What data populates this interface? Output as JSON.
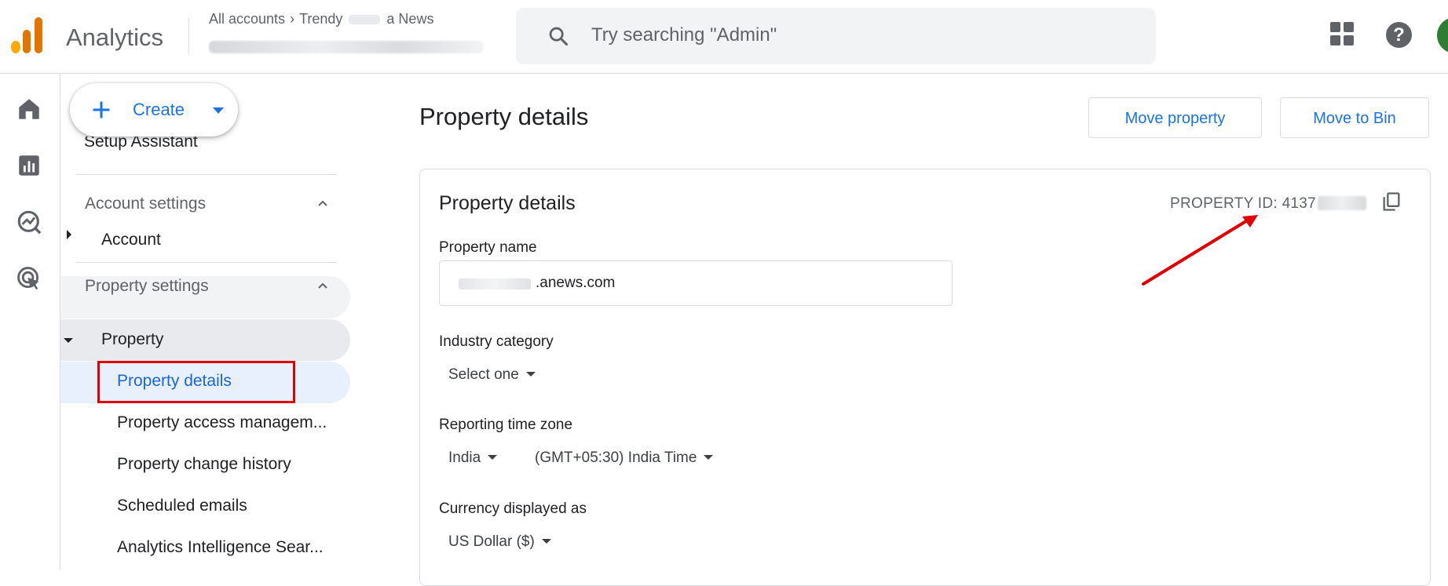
{
  "header": {
    "app_name": "Analytics",
    "breadcrumb_root": "All accounts",
    "breadcrumb_account": "Trendy",
    "breadcrumb_account_suffix": "a News",
    "search_placeholder": "Try searching \"Admin\""
  },
  "rail": {
    "items": [
      "home-icon",
      "reports-icon",
      "explore-icon",
      "advertising-icon"
    ]
  },
  "sidenav": {
    "create_label": "Create",
    "setup_assistant": "Setup Assistant",
    "account_settings": "Account settings",
    "account_item": "Account",
    "property_settings": "Property settings",
    "property_item": "Property",
    "sub_items": [
      "Property details",
      "Property access managem...",
      "Property change history",
      "Scheduled emails",
      "Analytics Intelligence Sear..."
    ]
  },
  "main": {
    "page_title": "Property details",
    "move_property": "Move property",
    "move_to_bin": "Move to Bin",
    "card_title": "Property details",
    "property_id_label": "PROPERTY ID: 4137",
    "fields": {
      "property_name_label": "Property name",
      "property_name_value": ".anews.com",
      "industry_label": "Industry category",
      "industry_value": "Select one",
      "timezone_label": "Reporting time zone",
      "timezone_country": "India",
      "timezone_value": "(GMT+05:30) India Time",
      "currency_label": "Currency displayed as",
      "currency_value": "US Dollar ($)"
    }
  },
  "colors": {
    "accent": "#1a73e8",
    "selected_text": "#1967d2",
    "annotation_red": "#e00000"
  }
}
